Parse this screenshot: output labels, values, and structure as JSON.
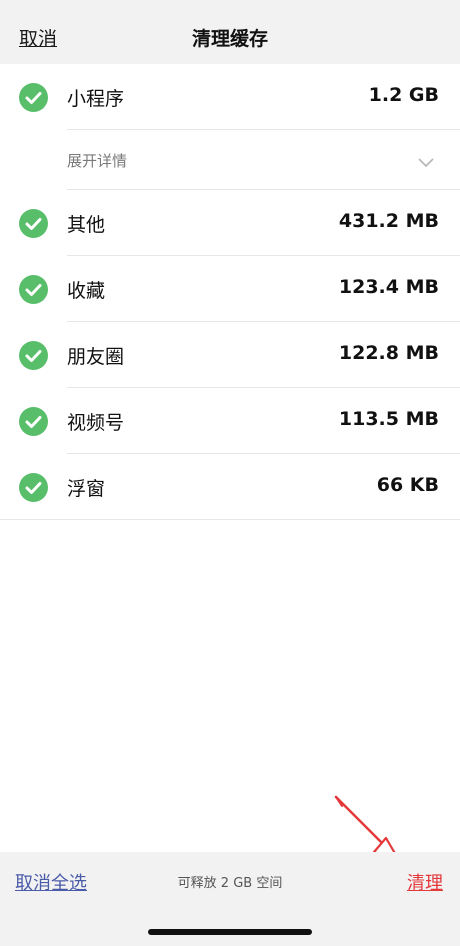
{
  "header": {
    "cancel_label": "取消",
    "title": "清理缓存"
  },
  "items": [
    {
      "label": "小程序",
      "size": "1.2 GB",
      "checked": true
    },
    {
      "label": "其他",
      "size": "431.2 MB",
      "checked": true
    },
    {
      "label": "收藏",
      "size": "123.4 MB",
      "checked": true
    },
    {
      "label": "朋友圈",
      "size": "122.8 MB",
      "checked": true
    },
    {
      "label": "视频号",
      "size": "113.5 MB",
      "checked": true
    },
    {
      "label": "浮窗",
      "size": "66 KB",
      "checked": true
    }
  ],
  "details": {
    "label": "展开详情"
  },
  "footer": {
    "deselect_label": "取消全选",
    "free_space": "可释放 2 GB 空间",
    "clean_label": "清理"
  },
  "colors": {
    "check_green": "#58be6a",
    "clean_red": "#e5383b",
    "link_blue": "#4a5ba8"
  }
}
